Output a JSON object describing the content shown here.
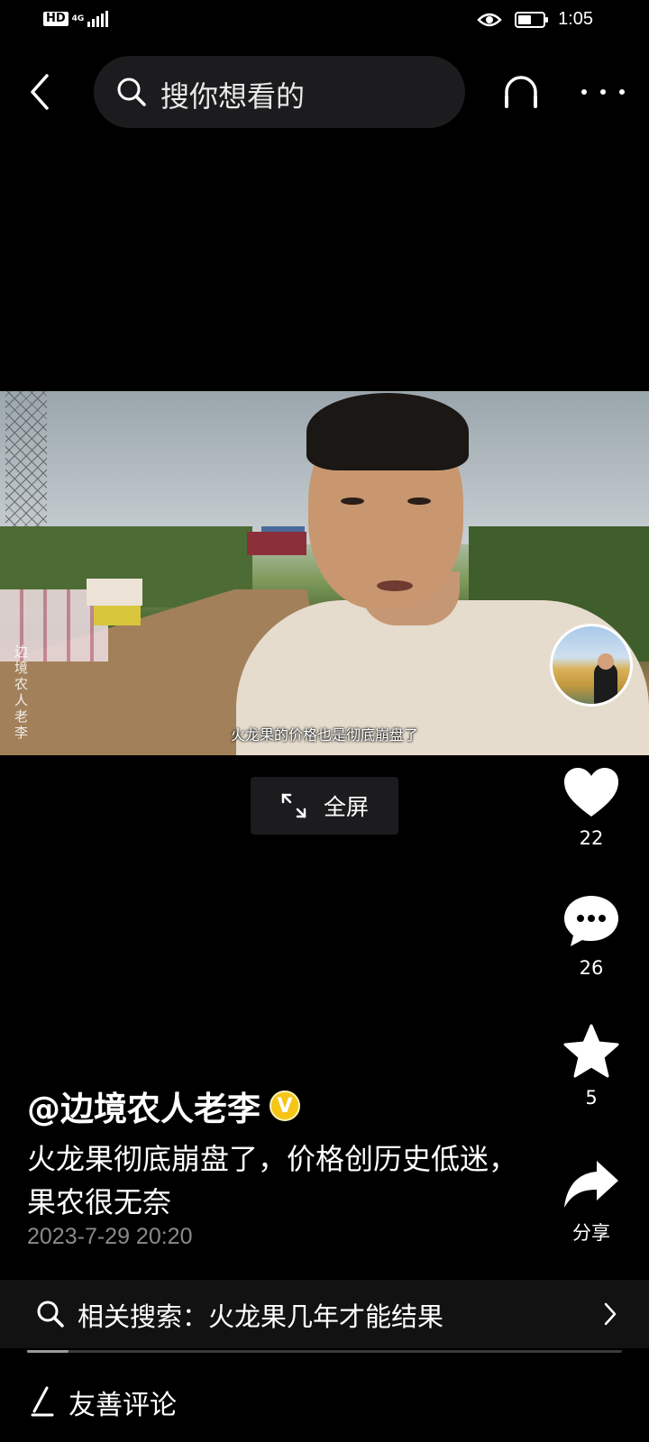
{
  "status_bar": {
    "hd": "HD",
    "network": "4G",
    "time": "1:05",
    "battery_level": 0.45
  },
  "top_nav": {
    "search_placeholder": "搜你想看的"
  },
  "video": {
    "subtitle": "火龙果的价格也是彻底崩盘了",
    "watermark": "边境农人老李",
    "fullscreen_label": "全屏"
  },
  "actions": {
    "like_count": "22",
    "comment_count": "26",
    "favorite_count": "5",
    "share_label": "分享"
  },
  "post": {
    "author": "@边境农人老李",
    "verified_badge": "V",
    "description": "火龙果彻底崩盘了，价格创历史低迷，果农很无奈",
    "date": "2023-7-29 20:20"
  },
  "related_search": {
    "text": "相关搜索：火龙果几年才能结果"
  },
  "playback_progress": 0.07,
  "comment_bar": {
    "placeholder": "友善评论"
  },
  "colors": {
    "background": "#000000",
    "panel": "#1c1c1e",
    "verified": "#f5c518",
    "muted_text": "#8a8a8a"
  }
}
